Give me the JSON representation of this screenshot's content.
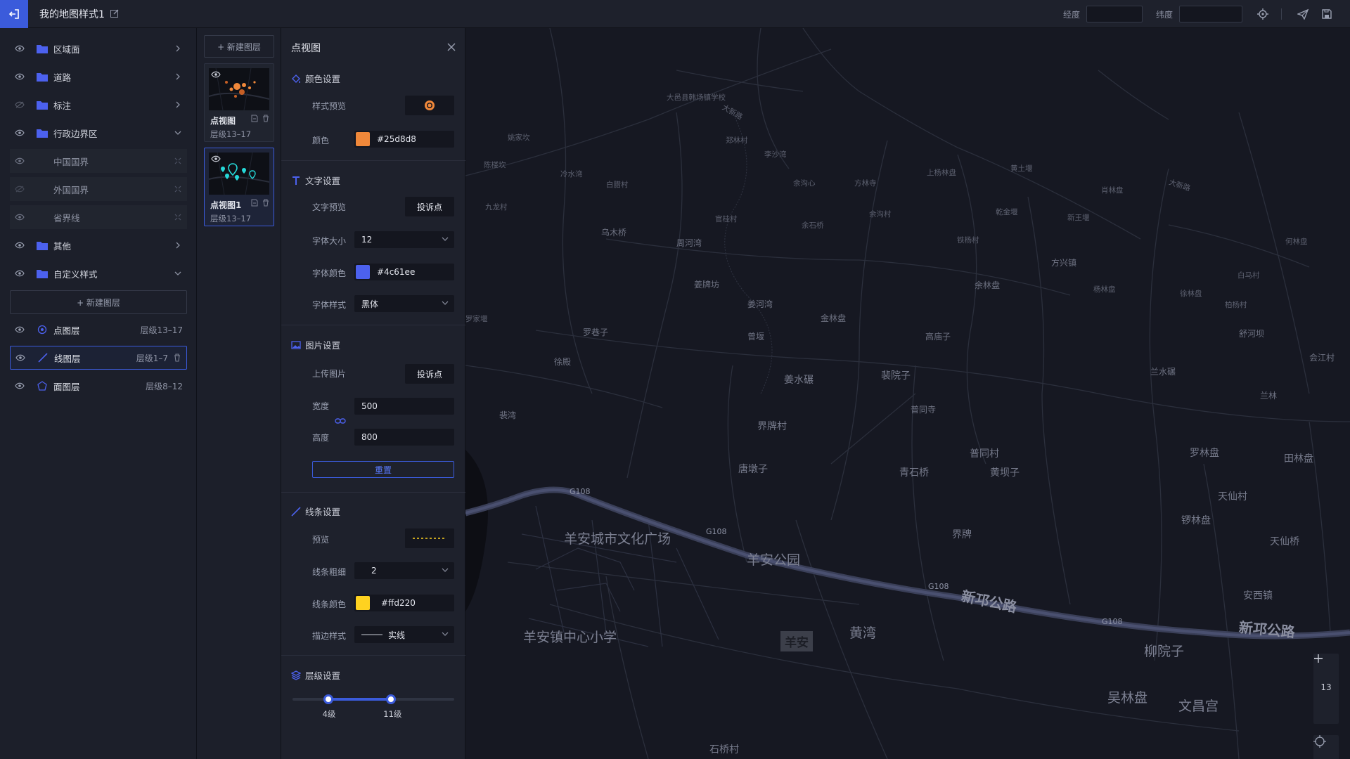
{
  "header": {
    "title": "我的地图样式1",
    "lng_label": "经度",
    "lat_label": "纬度",
    "lng_value": "",
    "lat_value": ""
  },
  "tree": {
    "items": [
      {
        "label": "区域面"
      },
      {
        "label": "道路"
      },
      {
        "label": "标注"
      },
      {
        "label": "行政边界区"
      },
      {
        "label": "中国国界"
      },
      {
        "label": "外国国界"
      },
      {
        "label": "省界线"
      },
      {
        "label": "其他"
      },
      {
        "label": "自定义样式"
      }
    ],
    "new_layer_label": "+ 新建图层"
  },
  "custom_layers": [
    {
      "label": "点图层",
      "level": "层级13–17"
    },
    {
      "label": "线图层",
      "level": "层级1–7"
    },
    {
      "label": "面图层",
      "level": "层级8–12"
    }
  ],
  "thumbs": {
    "new_layer_label": "+ 新建图层",
    "cards": [
      {
        "name": "点视图",
        "level": "层级13–17"
      },
      {
        "name": "点视图1",
        "level": "层级13–17"
      }
    ]
  },
  "props": {
    "title": "点视图",
    "color_section": {
      "title": "颜色设置",
      "preview_label": "样式预览",
      "color_label": "颜色",
      "color_value": "#25d8d8",
      "swatch": "#f0883a"
    },
    "text_section": {
      "title": "文字设置",
      "preview_label": "文字预览",
      "preview_text": "投诉点",
      "size_label": "字体大小",
      "size_value": "12",
      "color_label": "字体颜色",
      "color_value": "#4c61ee",
      "swatch": "#4c61ee",
      "style_label": "字体样式",
      "style_value": "黑体"
    },
    "image_section": {
      "title": "图片设置",
      "upload_label": "上传图片",
      "upload_button": "投诉点",
      "width_label": "宽度",
      "width_value": "500",
      "height_label": "高度",
      "height_value": "800",
      "reset_button": "重置"
    },
    "line_section": {
      "title": "线条设置",
      "preview_label": "预览",
      "width_label": "线条粗细",
      "width_value": "2",
      "color_label": "线条颜色",
      "color_value": "#ffd220",
      "swatch": "#ffd220",
      "stroke_label": "描边样式",
      "stroke_value": "实线"
    },
    "level_section": {
      "title": "层级设置",
      "min_label": "4级",
      "max_label": "11级",
      "min_fraction": 0.22,
      "max_fraction": 0.61
    }
  },
  "map": {
    "zoom_level": "13",
    "road_code": "G108",
    "labels": [
      "新邛公路",
      "新邛公路",
      "羊安城市文化广场",
      "羊安公园",
      "羊安镇中心小学",
      "羊安",
      "黄湾",
      "柳院子",
      "吴林盘",
      "文昌宫",
      "石桥村",
      "界牌",
      "黄坝子",
      "青石桥",
      "普同村",
      "普同寺",
      "界牌村",
      "唐墩子",
      "姜水碾",
      "裴院子",
      "高庙子",
      "罗林盘",
      "锣林盘",
      "天仙村",
      "天仙桥",
      "安西镇",
      "田林盘",
      "兰林",
      "兰水碾",
      "会江村",
      "罗家堰",
      "舒河坝",
      "柏杨村",
      "方兴镇",
      "余林盘",
      "金林盘",
      "姜河湾",
      "曾堰",
      "姜牌坊",
      "周河湾",
      "乌木桥",
      "罗巷子",
      "徐殿",
      "裴湾",
      "九龙村",
      "冷水湾",
      "白腊村",
      "官桂村",
      "余石桥",
      "余沟村",
      "余沟心",
      "方林寺",
      "上杨林盘",
      "铁杨村",
      "乾金堰",
      "新王堰",
      "肖林盘",
      "大新路",
      "大新路",
      "大邑县韩场镇学校",
      "何林盘",
      "白马村",
      "徐林盘",
      "杨林盘",
      "郑林村",
      "李沙湾",
      "黄土堰",
      "陈楼坎",
      "姚家坎"
    ]
  }
}
